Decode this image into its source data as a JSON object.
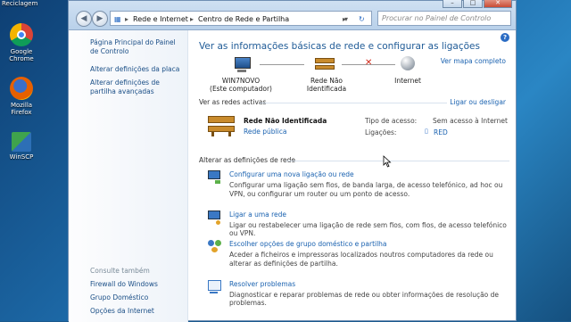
{
  "desktop": {
    "recycle_label": "Reciclagem",
    "icons": [
      {
        "label1": "Google",
        "label2": "Chrome"
      },
      {
        "label1": "Mozilla",
        "label2": "Firefox"
      },
      {
        "label1": "WinSCP",
        "label2": ""
      }
    ]
  },
  "titlebar": {
    "min": "–",
    "max": "□",
    "close": "✕"
  },
  "address": {
    "segments": [
      "Rede e Internet",
      "Centro de Rede e Partilha"
    ],
    "sep": "▸",
    "dropdown": "▾",
    "refresh": "↻"
  },
  "search": {
    "placeholder": "Procurar no Painel de Controlo"
  },
  "sidebar": {
    "links": [
      "Página Principal do Painel de Controlo",
      "Alterar definições da placa",
      "Alterar definições de partilha avançadas"
    ],
    "see_also": "Consulte também",
    "see_also_links": [
      "Firewall do Windows",
      "Grupo Doméstico",
      "Opções da Internet"
    ]
  },
  "main": {
    "title": "Ver as informações básicas de rede e configurar as ligações",
    "view_map": "Ver mapa completo",
    "help": "?",
    "map": {
      "computer_name": "WIN7NOVO",
      "computer_sub": "(Este computador)",
      "network": "Rede Não Identificada",
      "internet": "Internet"
    },
    "active_label": "Ver as redes activas",
    "connect_link": "Ligar ou desligar",
    "active": {
      "name": "Rede Não Identificada",
      "type": "Rede pública",
      "access_label": "Tipo de acesso:",
      "access_value": "Sem acesso à Internet",
      "connections_label": "Ligações:",
      "connections_value": "RED"
    },
    "change_label": "Alterar as definições de rede",
    "tasks": [
      {
        "title": "Configurar uma nova ligação ou rede",
        "desc": "Configurar uma ligação sem fios, de banda larga, de acesso telefónico, ad hoc ou VPN, ou configurar um router ou um ponto de acesso."
      },
      {
        "title": "Ligar a uma rede",
        "desc": "Ligar ou restabelecer uma ligação de rede sem fios, com fios, de acesso telefónico ou VPN."
      },
      {
        "title": "Escolher opções de grupo doméstico e partilha",
        "desc": "Aceder a ficheiros e impressoras localizados noutros computadores da rede ou alterar as definições de partilha."
      },
      {
        "title": "Resolver problemas",
        "desc": "Diagnosticar e reparar problemas de rede ou obter informações de resolução de problemas."
      }
    ]
  }
}
